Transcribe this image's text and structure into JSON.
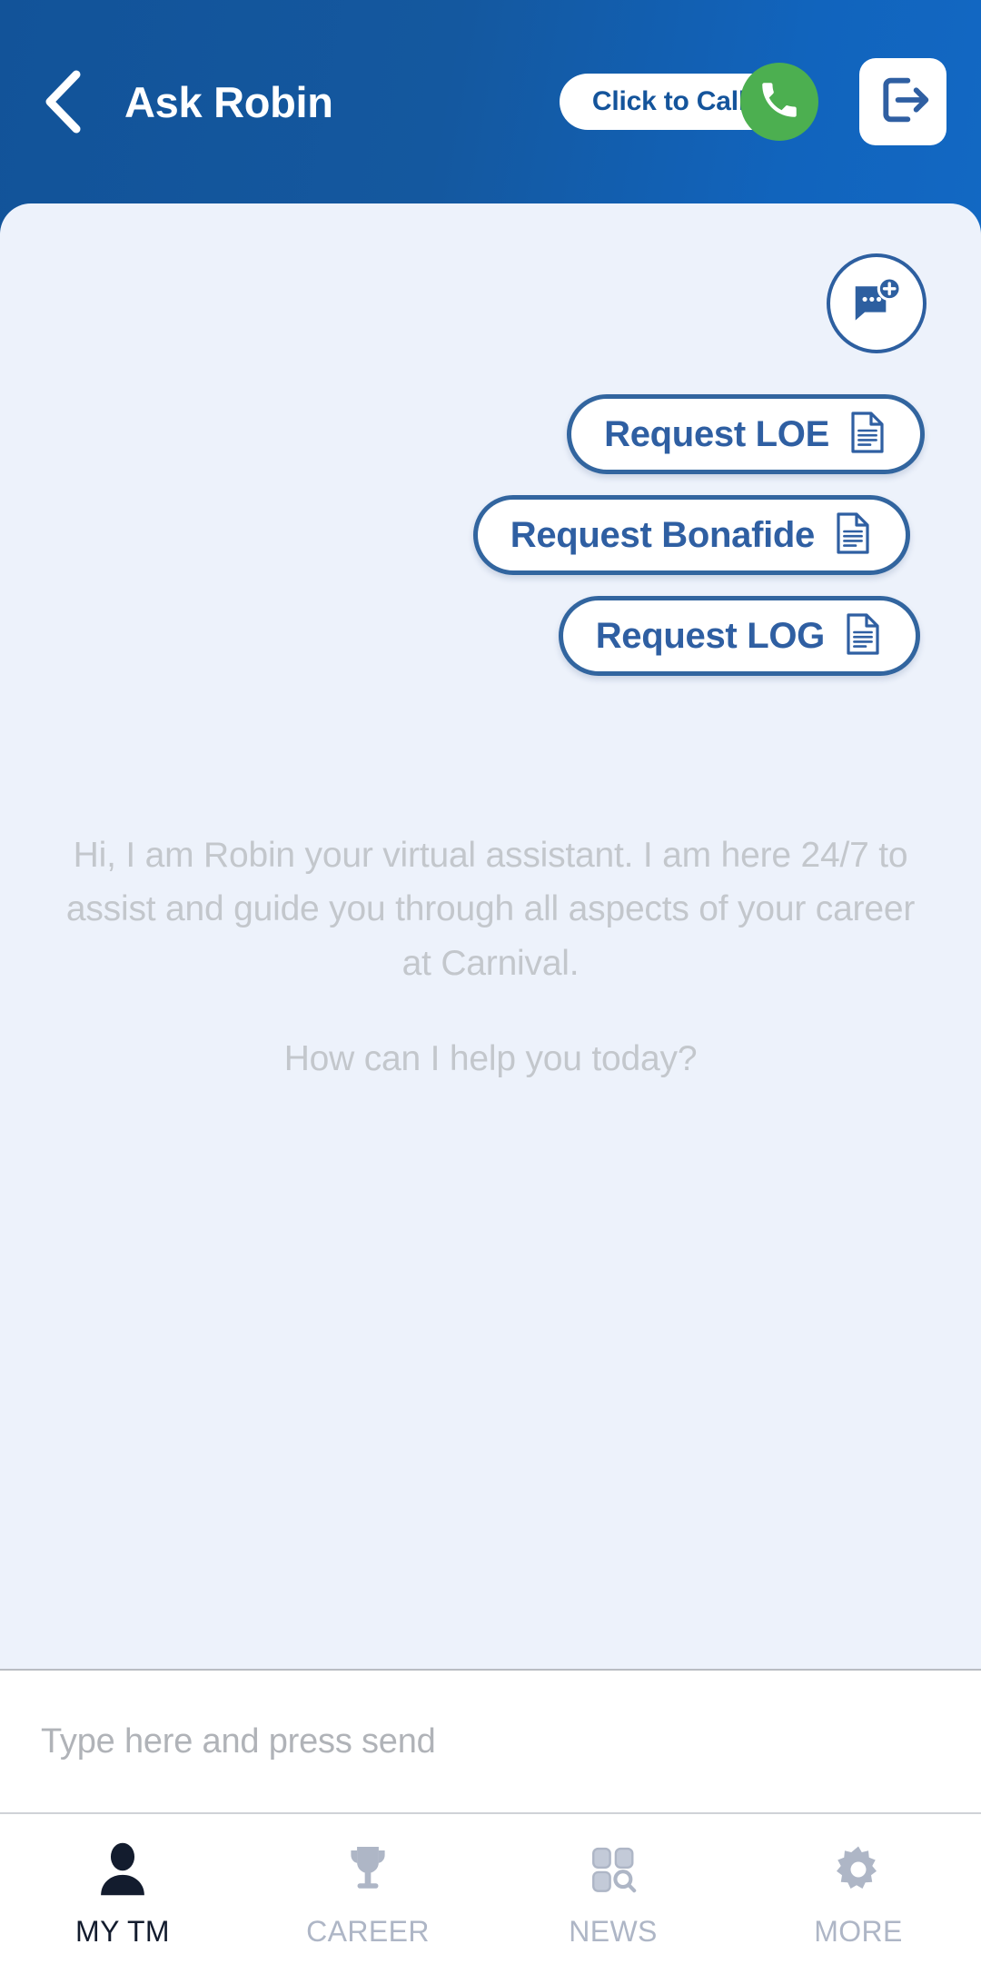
{
  "header": {
    "back_icon": "chevron-left-icon",
    "title": "Ask Robin",
    "call_button": {
      "label": "Click to Call",
      "icon": "phone-icon",
      "circle_color": "#4CAF50"
    },
    "logout": {
      "icon": "logout-icon",
      "color": "#2F5FA2"
    },
    "gradient_from": "#125399",
    "gradient_to": "#1268C3"
  },
  "chat": {
    "background": "#EDF2FB",
    "new_chat": {
      "icon": "new-chat-bubble-icon",
      "accent": "#2D5FA0"
    },
    "quick_actions": [
      {
        "label": "Request LOE",
        "icon": "document-icon"
      },
      {
        "label": "Request Bonafide",
        "icon": "document-icon"
      },
      {
        "label": "Request LOG",
        "icon": "document-icon"
      }
    ],
    "greeting": "Hi, I am Robin your virtual assistant. I am here 24/7 to assist and guide you through all aspects of your career at Carnival.",
    "greeting_question": "How can I help you today?",
    "greeting_color": "#C3C7CC"
  },
  "input": {
    "placeholder": "Type here and press send",
    "value": ""
  },
  "tabbar": {
    "active_color": "#131C2E",
    "inactive_color": "#AEB6C6",
    "tabs": [
      {
        "label": "MY TM",
        "icon": "person-icon",
        "active": true
      },
      {
        "label": "CAREER",
        "icon": "trophy-icon",
        "active": false
      },
      {
        "label": "NEWS",
        "icon": "grid-search-icon",
        "active": false
      },
      {
        "label": "MORE",
        "icon": "gear-icon",
        "active": false
      }
    ]
  }
}
